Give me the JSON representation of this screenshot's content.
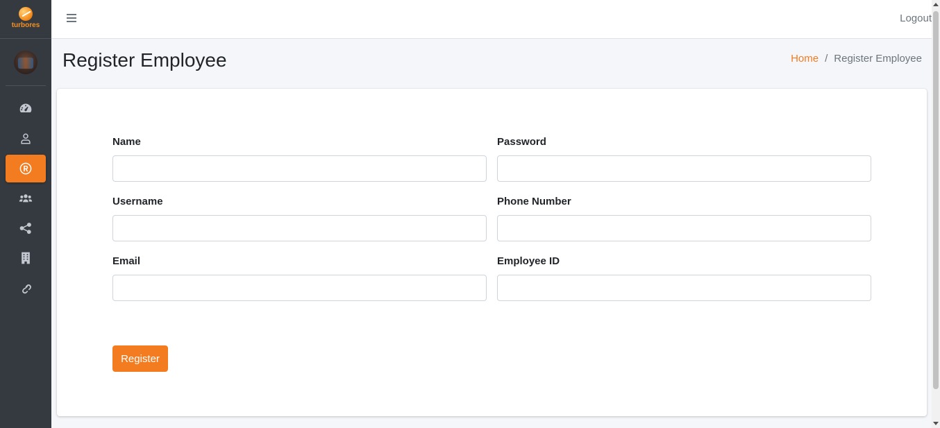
{
  "brand": {
    "name": "turbores",
    "icon": "basketball-logo-icon",
    "accent_color": "#f47c20"
  },
  "sidebar": {
    "items": [
      {
        "name": "dashboard",
        "icon": "tachometer-icon",
        "active": false
      },
      {
        "name": "profile",
        "icon": "user-icon",
        "active": false
      },
      {
        "name": "register",
        "icon": "registered-icon",
        "active": true
      },
      {
        "name": "employees",
        "icon": "users-icon",
        "active": false
      },
      {
        "name": "share",
        "icon": "share-icon",
        "active": false
      },
      {
        "name": "building",
        "icon": "building-icon",
        "active": false
      },
      {
        "name": "links",
        "icon": "link-icon",
        "active": false
      }
    ]
  },
  "navbar": {
    "logout_label": "Logout"
  },
  "header": {
    "title": "Register Employee",
    "breadcrumb": {
      "home": "Home",
      "separator": "/",
      "current": "Register Employee"
    }
  },
  "form": {
    "name_label": "Name",
    "name_value": "",
    "password_label": "Password",
    "password_value": "",
    "username_label": "Username",
    "username_value": "",
    "phone_label": "Phone Number",
    "phone_value": "",
    "email_label": "Email",
    "email_value": "",
    "employee_id_label": "Employee ID",
    "employee_id_value": "",
    "submit_label": "Register"
  }
}
